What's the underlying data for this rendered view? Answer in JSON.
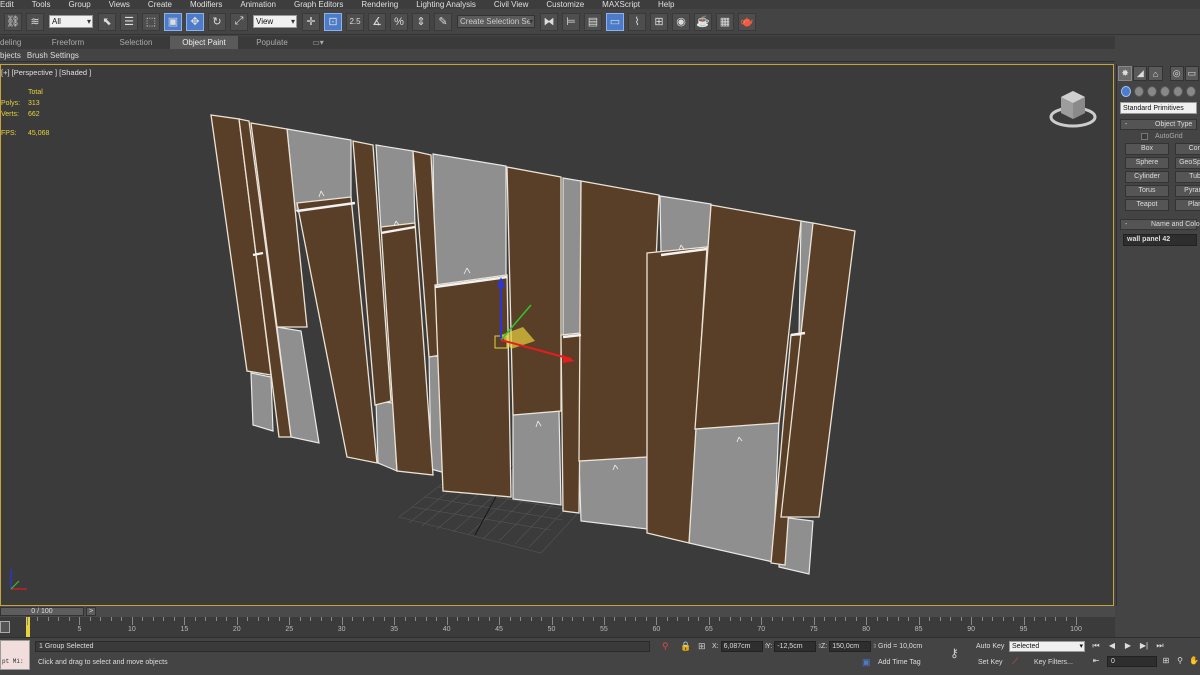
{
  "menu": [
    "Edit",
    "Tools",
    "Group",
    "Views",
    "Create",
    "Modifiers",
    "Animation",
    "Graph Editors",
    "Rendering",
    "Lighting Analysis",
    "Civil View",
    "Customize",
    "MAXScript",
    "Help"
  ],
  "toolbar": {
    "selection_filter": "All",
    "reference_coord": "View",
    "snap_label": "2.5",
    "named_selection": "Create Selection Se"
  },
  "ribbon": {
    "tabs": [
      "deling",
      "Freeform",
      "Selection",
      "Object Paint",
      "Populate"
    ],
    "active_tab": "Object Paint",
    "sub_tabs": [
      "bjects",
      "Brush Settings"
    ]
  },
  "viewport": {
    "label": "[+] [Perspective ] [Shaded ]",
    "stats": {
      "total_label": "Total",
      "polys_label": "Polys:",
      "polys": "313",
      "verts_label": "Verts:",
      "verts": "662",
      "fps_label": "FPS:",
      "fps": "45,068"
    },
    "object_colors": {
      "wood": "#5a3f28",
      "concrete": "#8f8f8f",
      "edge": "#e8e8e8",
      "selection_border": "#c8a33c"
    }
  },
  "command_panel": {
    "category": "Standard Primitives",
    "object_type_title": "Object Type",
    "autogrid_label": "AutoGrid",
    "buttons": [
      "Box",
      "Cone",
      "Sphere",
      "GeoSphere",
      "Cylinder",
      "Tube",
      "Torus",
      "Pyramid",
      "Teapot",
      "Plane"
    ],
    "name_color_title": "Name and Color",
    "object_name": "wall panel 42"
  },
  "timeline": {
    "slider_label": "0 / 100",
    "ticks": [
      0,
      5,
      10,
      15,
      20,
      25,
      30,
      35,
      40,
      45,
      50,
      55,
      60,
      65,
      70,
      75,
      80,
      85,
      90,
      95,
      100
    ],
    "current_frame": 0
  },
  "status": {
    "mini_listener": "pt Mi:",
    "selection_info": "1 Group Selected",
    "prompt": "Click and drag to select and move objects",
    "x_label": "X:",
    "x": "6,087cm",
    "y_label": "Y:",
    "y": "-12,5cm",
    "z_label": "Z:",
    "z": "150,0cm",
    "grid": "Grid = 10,0cm",
    "add_time_tag": "Add Time Tag",
    "auto_key": "Auto Key",
    "set_key": "Set Key",
    "key_mode": "Selected",
    "key_filters": "Key Filters...",
    "frame": "0"
  }
}
